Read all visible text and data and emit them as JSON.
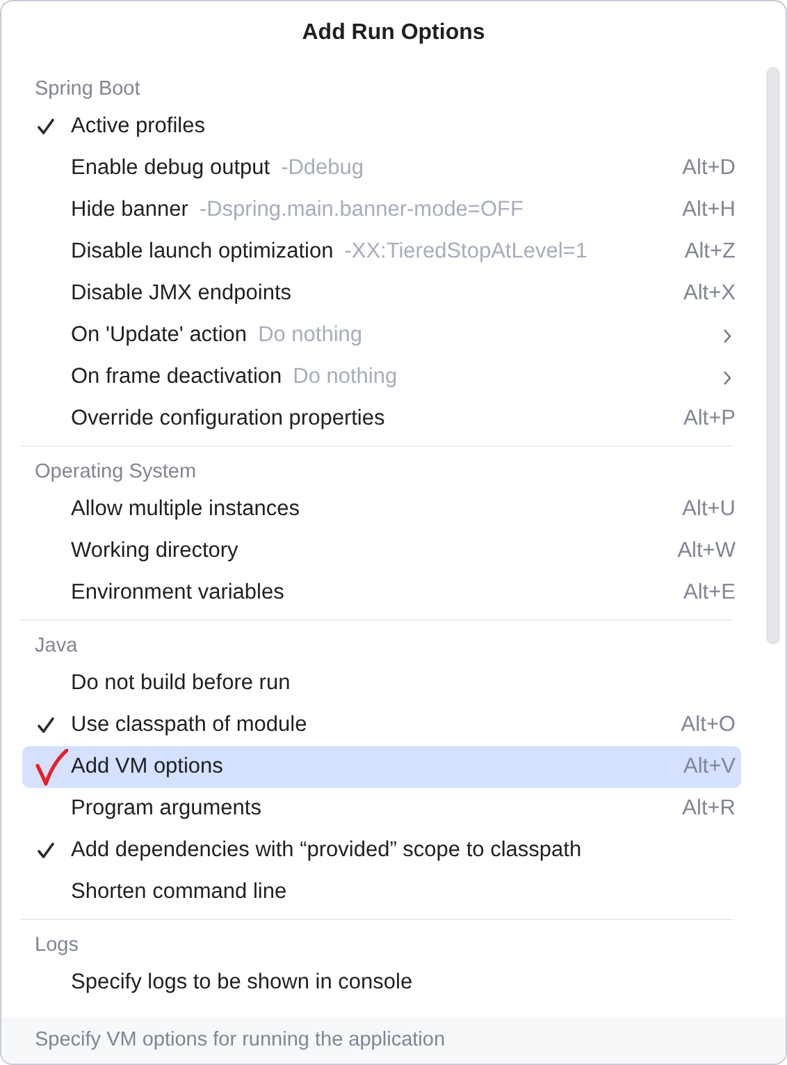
{
  "popup": {
    "title": "Add Run Options",
    "sections": [
      {
        "header": "Spring Boot",
        "items": [
          {
            "label": "Active profiles",
            "kind": "option",
            "checked": true,
            "selected": false,
            "annotated": false
          },
          {
            "label": "Enable debug output",
            "hint": "-Ddebug",
            "shortcut": "Alt+D",
            "kind": "option",
            "checked": false,
            "selected": false,
            "annotated": false
          },
          {
            "label": "Hide banner",
            "hint": "-Dspring.main.banner-mode=OFF",
            "shortcut": "Alt+H",
            "kind": "option",
            "checked": false,
            "selected": false,
            "annotated": false
          },
          {
            "label": "Disable launch optimization",
            "hint": "-XX:TieredStopAtLevel=1",
            "shortcut": "Alt+Z",
            "kind": "option",
            "checked": false,
            "selected": false,
            "annotated": false
          },
          {
            "label": "Disable JMX endpoints",
            "shortcut": "Alt+X",
            "kind": "option",
            "checked": false,
            "selected": false,
            "annotated": false
          },
          {
            "label": "On 'Update' action",
            "hint": "Do nothing",
            "kind": "submenu",
            "checked": false,
            "selected": false,
            "annotated": false
          },
          {
            "label": "On frame deactivation",
            "hint": "Do nothing",
            "kind": "submenu",
            "checked": false,
            "selected": false,
            "annotated": false
          },
          {
            "label": "Override configuration properties",
            "shortcut": "Alt+P",
            "kind": "option",
            "checked": false,
            "selected": false,
            "annotated": false
          }
        ]
      },
      {
        "header": "Operating System",
        "items": [
          {
            "label": "Allow multiple instances",
            "shortcut": "Alt+U",
            "kind": "option",
            "checked": false,
            "selected": false,
            "annotated": false
          },
          {
            "label": "Working directory",
            "shortcut": "Alt+W",
            "kind": "option",
            "checked": false,
            "selected": false,
            "annotated": false
          },
          {
            "label": "Environment variables",
            "shortcut": "Alt+E",
            "kind": "option",
            "checked": false,
            "selected": false,
            "annotated": false
          }
        ]
      },
      {
        "header": "Java",
        "items": [
          {
            "label": "Do not build before run",
            "kind": "option",
            "checked": false,
            "selected": false,
            "annotated": false
          },
          {
            "label": "Use classpath of module",
            "shortcut": "Alt+O",
            "kind": "option",
            "checked": true,
            "selected": false,
            "annotated": false
          },
          {
            "label": "Add VM options",
            "shortcut": "Alt+V",
            "kind": "option",
            "checked": false,
            "selected": true,
            "annotated": true
          },
          {
            "label": "Program arguments",
            "shortcut": "Alt+R",
            "kind": "option",
            "checked": false,
            "selected": false,
            "annotated": false
          },
          {
            "label": "Add dependencies with “provided” scope to classpath",
            "kind": "option",
            "checked": true,
            "selected": false,
            "annotated": false
          },
          {
            "label": "Shorten command line",
            "kind": "option",
            "checked": false,
            "selected": false,
            "annotated": false
          }
        ]
      },
      {
        "header": "Logs",
        "items": [
          {
            "label": "Specify logs to be shown in console",
            "kind": "option",
            "checked": false,
            "selected": false,
            "annotated": false
          }
        ]
      }
    ],
    "footer": "Specify VM options for running the application"
  }
}
